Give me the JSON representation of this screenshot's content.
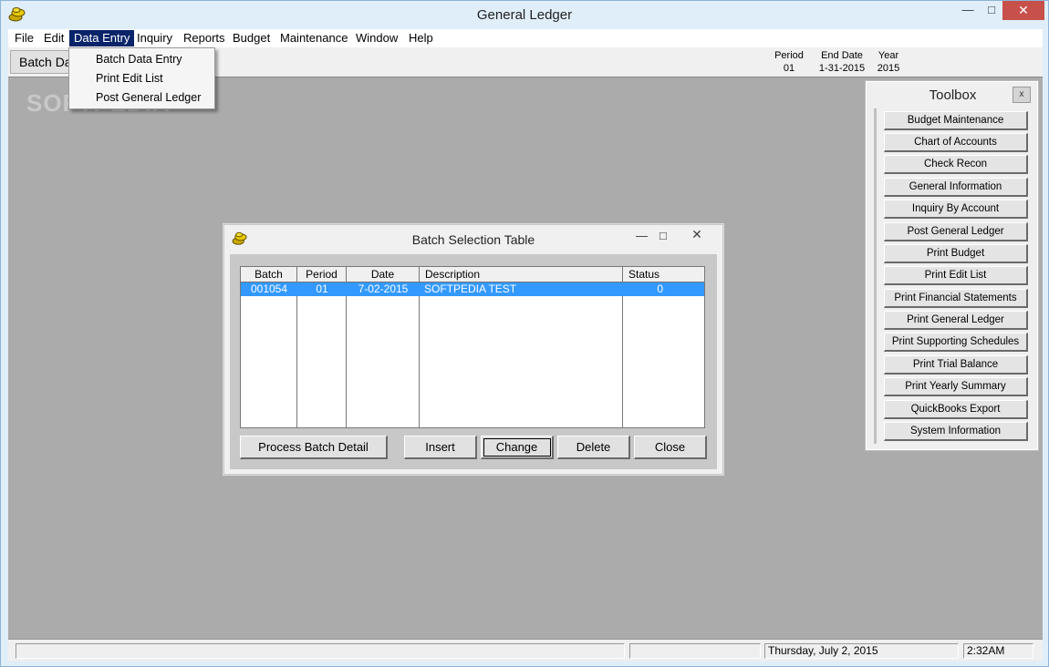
{
  "window": {
    "title": "General Ledger"
  },
  "menu": {
    "items": [
      "File",
      "Edit",
      "Data Entry",
      "Inquiry",
      "Reports",
      "Budget",
      "Maintenance",
      "Window",
      "Help"
    ],
    "active": "Data Entry",
    "dropdown": [
      "Batch Data Entry",
      "Print Edit List",
      "Post General Ledger"
    ]
  },
  "toolbar": {
    "tab_label": "Batch Data",
    "period_label": "Period",
    "period_value": "01",
    "end_date_label": "End Date",
    "end_date_value": "1-31-2015",
    "year_label": "Year",
    "year_value": "2015"
  },
  "watermark": "SOFTPEDIA",
  "toolbox": {
    "title": "Toolbox",
    "close": "x",
    "buttons": [
      "Budget Maintenance",
      "Chart of Accounts",
      "Check Recon",
      "General Information",
      "Inquiry By Account",
      "Post General Ledger",
      "Print Budget",
      "Print Edit List",
      "Print Financial Statements",
      "Print General Ledger",
      "Print Supporting Schedules",
      "Print Trial Balance",
      "Print Yearly Summary",
      "QuickBooks Export",
      "System Information"
    ]
  },
  "dialog": {
    "title": "Batch Selection Table",
    "columns": [
      "Batch",
      "Period",
      "Date",
      "Description",
      "Status"
    ],
    "rows": [
      {
        "batch": "001054",
        "period": "01",
        "date": "7-02-2015",
        "description": "SOFTPEDIA TEST",
        "status": "0"
      }
    ],
    "buttons": {
      "process": "Process Batch Detail",
      "insert": "Insert",
      "change": "Change",
      "delete": "Delete",
      "close": "Close"
    }
  },
  "statusbar": {
    "date": "Thursday, July  2, 2015",
    "time": "2:32AM"
  },
  "colors": {
    "accent": "#0a246a",
    "selection": "#3399ff",
    "workspace": "#ababab",
    "close": "#c7514a"
  }
}
